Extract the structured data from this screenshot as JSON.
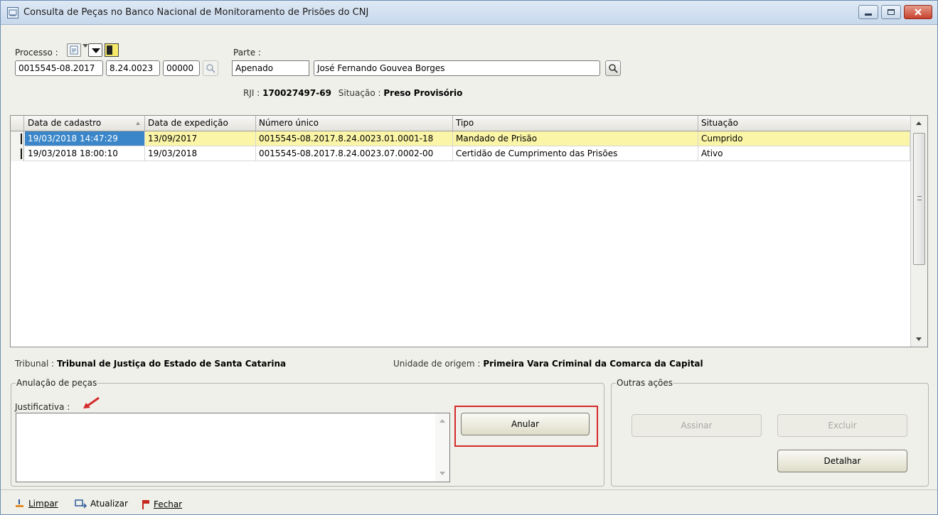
{
  "window": {
    "title": "Consulta de Peças no Banco Nacional de Monitoramento de Prisões do CNJ"
  },
  "processo": {
    "label": "Processo :",
    "part1": "0015545-08.2017",
    "part2": "8.24.0023",
    "part3": "00000"
  },
  "parte": {
    "label": "Parte :",
    "tipo": "Apenado",
    "nome": "José Fernando Gouvea Borges"
  },
  "info": {
    "rji_label": "RJI :",
    "rji_value": "170027497-69",
    "situacao_label": "Situação :",
    "situacao_value": "Preso Provisório"
  },
  "grid": {
    "columns": [
      "Data de cadastro",
      "Data de expedição",
      "Número único",
      "Tipo",
      "Situação"
    ],
    "rows": [
      [
        "19/03/2018 14:47:29",
        "13/09/2017",
        "0015545-08.2017.8.24.0023.01.0001-18",
        "Mandado de Prisão",
        "Cumprido"
      ],
      [
        "19/03/2018 18:00:10",
        "19/03/2018",
        "0015545-08.2017.8.24.0023.07.0002-00",
        "Certidão de Cumprimento das Prisões",
        "Ativo"
      ]
    ]
  },
  "tribunal": {
    "label": "Tribunal :",
    "value": "Tribunal de Justiça do Estado de Santa Catarina"
  },
  "unidade": {
    "label": "Unidade de origem :",
    "value": "Primeira Vara Criminal da Comarca da Capital"
  },
  "anulacao": {
    "group_title": "Anulação de peças",
    "justificativa_label": "Justificativa :",
    "justificativa_value": "",
    "anular_label": "Anular"
  },
  "outras": {
    "group_title": "Outras ações",
    "assinar_label": "Assinar",
    "excluir_label": "Excluir",
    "detalhar_label": "Detalhar"
  },
  "footer": {
    "limpar_label": "Limpar",
    "atualizar_label": "Atualizar",
    "fechar_label": "Fechar"
  },
  "colors": {
    "highlight_row": "#fbf5a8",
    "selected_cell": "#3a86c9",
    "annotation_red": "#d42a2a"
  }
}
